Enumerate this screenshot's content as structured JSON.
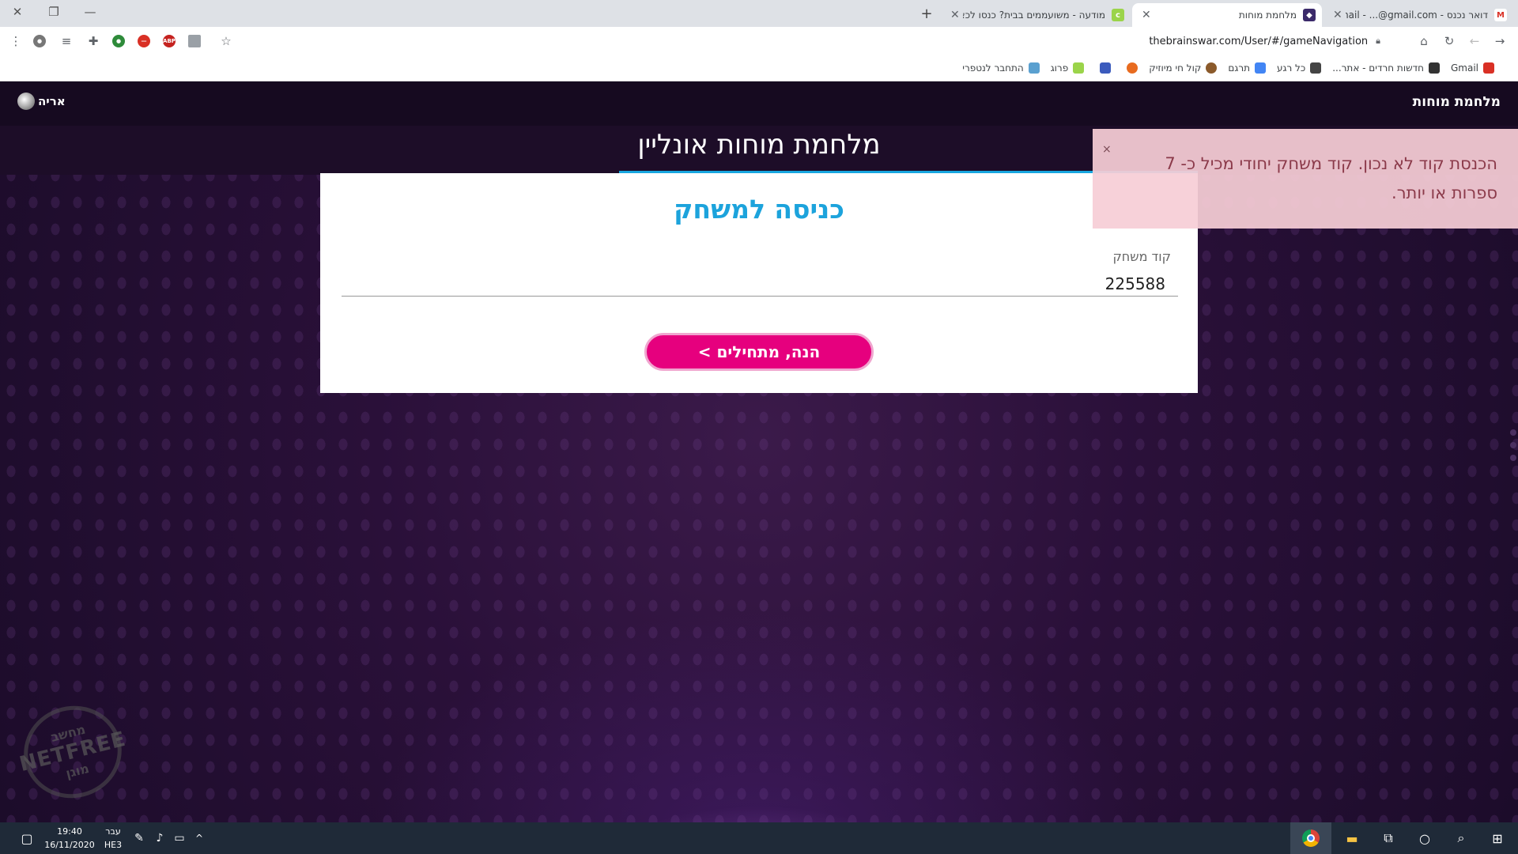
{
  "browser": {
    "tabs": [
      {
        "title": "דואר נכנס - Gmail - ...@gmail.com",
        "active": false
      },
      {
        "title": "מלחמת מוחות",
        "active": true
      },
      {
        "title": "מודעה - משועממים בבית? כנסו לכאן",
        "active": false
      }
    ],
    "url": "thebrainswar.com/User/#/gameNavigation",
    "bookmarks": [
      "Gmail",
      "חדשות חרדים - אתר...",
      "כל רגע",
      "תרגם",
      "קול חי מיוזיק",
      "",
      "",
      "פרוג",
      "התחבר לנטפרי"
    ]
  },
  "site": {
    "brand": "מלחמת מוחות",
    "user_name": "אריה",
    "headline": "מלחמת מוחות אונליין"
  },
  "join_form": {
    "title": "כניסה למשחק",
    "code_label": "קוד משחק",
    "code_value": "225588",
    "start_button": "הנה, מתחילים >"
  },
  "toast": {
    "message": "הכנסת קוד לא נכון. קוד משחק יחודי מכיל כ- 7 ספרות או יותר.",
    "close": "×"
  },
  "watermark": {
    "line1": "מחשב",
    "line2": "NETFREE",
    "line3": "מוגן"
  },
  "taskbar": {
    "time": "19:40",
    "date": "16/11/2020",
    "lang_top": "עבר",
    "lang_bottom": "HE3"
  },
  "colors": {
    "accent_blue": "#1ca3dc",
    "button_pink": "#e6007e",
    "toast_bg": "#f6ced6"
  }
}
